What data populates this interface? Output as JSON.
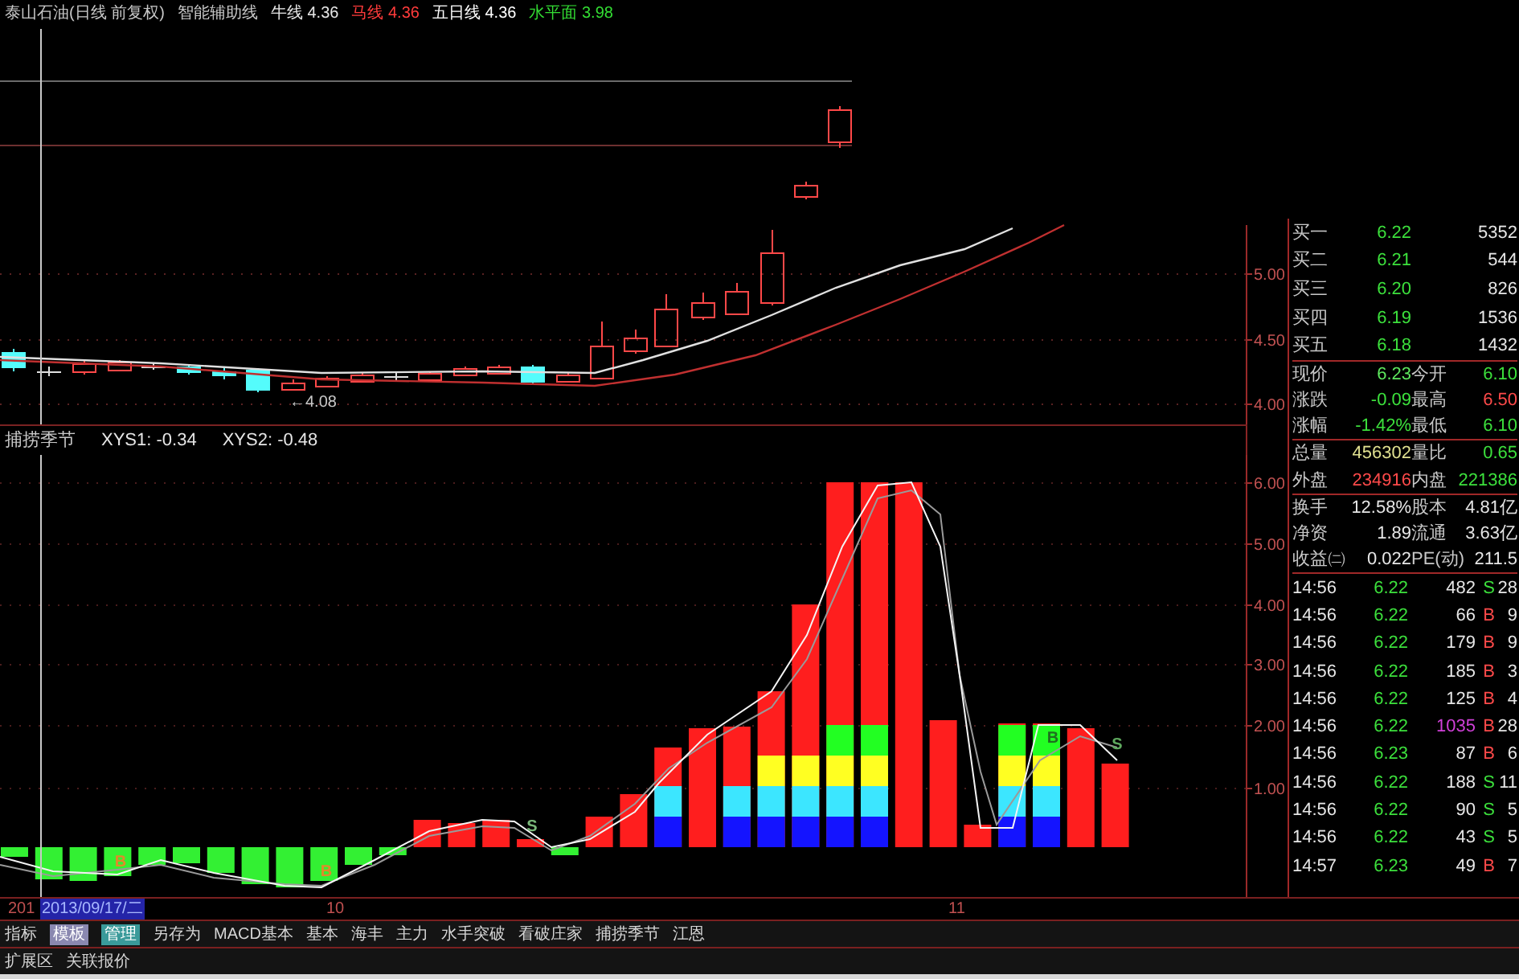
{
  "main_chart": {
    "title": "泰山石油(日线 前复权)",
    "indicator_name": "智能辅助线",
    "legend": [
      {
        "label": "牛线",
        "value": "4.36",
        "color": "#e6e6e6"
      },
      {
        "label": "马线",
        "value": "4.36",
        "color": "#ff3b3b"
      },
      {
        "label": "五日线",
        "value": "4.36",
        "color": "#ffffff"
      },
      {
        "label": "水平面",
        "value": "3.98",
        "color": "#33dd33"
      }
    ],
    "low_label": "←4.08",
    "axis_labels": [
      "5.00",
      "4.50",
      "4.00"
    ]
  },
  "indicator": {
    "title": "捕捞季节",
    "readouts": [
      "XYS1: -0.34",
      "XYS2: -0.48"
    ],
    "signals": [
      {
        "text": "B",
        "color": "#e08a2a"
      },
      {
        "text": "B",
        "color": "#e08a2a"
      },
      {
        "text": "S",
        "color": "#7ab87a"
      },
      {
        "text": "B",
        "color": "#1f6f1f"
      },
      {
        "text": "S",
        "color": "#5ea85e"
      }
    ],
    "axis_labels": [
      "6.00",
      "5.00",
      "4.00",
      "3.00",
      "2.00",
      "1.00"
    ]
  },
  "order_book": [
    {
      "label": "买一",
      "price": "6.22",
      "volume": "5352"
    },
    {
      "label": "买二",
      "price": "6.21",
      "volume": "544"
    },
    {
      "label": "买三",
      "price": "6.20",
      "volume": "826"
    },
    {
      "label": "买四",
      "price": "6.19",
      "volume": "1536"
    },
    {
      "label": "买五",
      "price": "6.18",
      "volume": "1432"
    }
  ],
  "quote_groups": [
    {
      "rows": [
        {
          "cells": [
            {
              "label": "现价",
              "value": "6.23",
              "color": "#5ee85e"
            },
            {
              "label": "今开",
              "value": "6.10",
              "color": "#3ce03c"
            }
          ]
        },
        {
          "cells": [
            {
              "label": "涨跌",
              "value": "-0.09",
              "color": "#3ce03c"
            },
            {
              "label": "最高",
              "value": "6.50",
              "color": "#ff4a4a"
            }
          ]
        },
        {
          "cells": [
            {
              "label": "涨幅",
              "value": "-1.42%",
              "color": "#3ce03c"
            },
            {
              "label": "最低",
              "value": "6.10",
              "color": "#3ce03c"
            }
          ]
        }
      ]
    },
    {
      "rows": [
        {
          "cells": [
            {
              "label": "总量",
              "value": "456302",
              "color": "#e0e090"
            },
            {
              "label": "量比",
              "value": "0.65",
              "color": "#3ce03c"
            }
          ]
        },
        {
          "cells": [
            {
              "label": "外盘",
              "value": "234916",
              "color": "#ff4a4a"
            },
            {
              "label": "内盘",
              "value": "221386",
              "color": "#3ce03c"
            }
          ]
        }
      ]
    },
    {
      "rows": [
        {
          "cells": [
            {
              "label": "换手",
              "value": "12.58%",
              "color": "#e6e6e6"
            },
            {
              "label": "股本",
              "value": "4.81亿",
              "color": "#e6e6e6"
            }
          ]
        },
        {
          "cells": [
            {
              "label": "净资",
              "value": "1.89",
              "color": "#e6e6e6"
            },
            {
              "label": "流通",
              "value": "3.63亿",
              "color": "#e6e6e6"
            }
          ]
        },
        {
          "cells": [
            {
              "label": "收益㈡",
              "value": "0.022",
              "color": "#e6e6e6"
            },
            {
              "label": "PE(动)",
              "value": "211.5",
              "color": "#e6e6e6"
            }
          ]
        }
      ]
    }
  ],
  "ticks": [
    {
      "time": "14:56",
      "price": "6.22",
      "volume": "482",
      "side": "S",
      "kind": "sell",
      "count": "28",
      "large": false
    },
    {
      "time": "14:56",
      "price": "6.22",
      "volume": "66",
      "side": "B",
      "kind": "buy",
      "count": "9",
      "large": false
    },
    {
      "time": "14:56",
      "price": "6.22",
      "volume": "179",
      "side": "B",
      "kind": "buy",
      "count": "9",
      "large": false
    },
    {
      "time": "14:56",
      "price": "6.22",
      "volume": "185",
      "side": "B",
      "kind": "buy",
      "count": "3",
      "large": false
    },
    {
      "time": "14:56",
      "price": "6.22",
      "volume": "125",
      "side": "B",
      "kind": "buy",
      "count": "4",
      "large": false
    },
    {
      "time": "14:56",
      "price": "6.22",
      "volume": "1035",
      "side": "B",
      "kind": "buy",
      "count": "28",
      "large": true
    },
    {
      "time": "14:56",
      "price": "6.23",
      "volume": "87",
      "side": "B",
      "kind": "buy",
      "count": "6",
      "large": false
    },
    {
      "time": "14:56",
      "price": "6.22",
      "volume": "188",
      "side": "S",
      "kind": "sell",
      "count": "11",
      "large": false
    },
    {
      "time": "14:56",
      "price": "6.22",
      "volume": "90",
      "side": "S",
      "kind": "sell",
      "count": "5",
      "large": false
    },
    {
      "time": "14:56",
      "price": "6.22",
      "volume": "43",
      "side": "S",
      "kind": "sell",
      "count": "5",
      "large": false
    },
    {
      "time": "14:57",
      "price": "6.23",
      "volume": "49",
      "side": "B",
      "kind": "buy",
      "count": "7",
      "large": false
    }
  ],
  "date_axis": {
    "labels": [
      "201",
      "10",
      "11"
    ],
    "cursor_date": "2013/09/17/二"
  },
  "tabs": [
    {
      "label": "指标",
      "kind": "tab"
    },
    {
      "label": "模板",
      "kind": "button",
      "color": "#8a88b0"
    },
    {
      "label": "管理",
      "kind": "button",
      "color": "#3a9a9a"
    },
    {
      "label": "另存为",
      "kind": "tab"
    },
    {
      "label": "MACD基本",
      "kind": "tab"
    },
    {
      "label": "基本",
      "kind": "tab"
    },
    {
      "label": "海丰",
      "kind": "tab"
    },
    {
      "label": "主力",
      "kind": "tab"
    },
    {
      "label": "水手突破",
      "kind": "tab"
    },
    {
      "label": "看破庄家",
      "kind": "tab"
    },
    {
      "label": "捕捞季节",
      "kind": "tab"
    },
    {
      "label": "江恩",
      "kind": "tab"
    }
  ],
  "bottom_tabs": [
    {
      "label": "扩展区"
    },
    {
      "label": "关联报价"
    }
  ]
}
